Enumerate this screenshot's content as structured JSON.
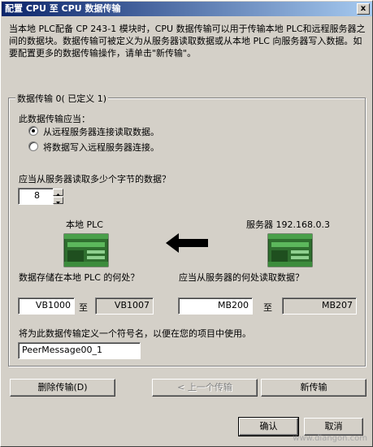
{
  "window": {
    "title": "配置 CPU 至 CPU 数据传输",
    "close_glyph": "x"
  },
  "description": "当本地 PLC配备 CP 243-1 模块时，CPU 数据传输可以用于传输本地 PLC和远程服务器之间的数据块。数据传输可被定义为从服务器读取数据或从本地 PLC 向服务器写入数据。如要配置更多的数据传输操作，请单击\"新传输\"。",
  "group": {
    "legend": "数据传输 0( 已定义 1)",
    "direction_prompt": "此数据传输应当：",
    "options": [
      {
        "label": "从远程服务器连接读取数据。",
        "selected": true
      },
      {
        "label": "将数据写入远程服务器连接。",
        "selected": false
      }
    ],
    "bytes_prompt": "应当从服务器读取多少个字节的数据？",
    "bytes_value": "8",
    "local_label": "本地 PLC",
    "server_label": "服务器 192.168.0.3",
    "local_store_prompt": "数据存储在本地 PLC 的何处？",
    "server_read_prompt": "应当从服务器的何处读取数据？",
    "local_from": "VB1000",
    "local_to_word": "至",
    "local_to": "VB1007",
    "server_from": "MB200",
    "server_to_word": "至",
    "server_to": "MB207",
    "symbol_prompt": "将为此数据传输定义一个符号名，以便在您的项目中使用。",
    "symbol_value": "PeerMessage00_1"
  },
  "buttons": {
    "delete": "删除传输(D)",
    "prev": "< 上一个传输",
    "new": "新传输",
    "ok": "确认",
    "cancel": "取消"
  },
  "watermark": "www.diangon.com",
  "colors": {
    "titlebar_start": "#0a246a",
    "titlebar_end": "#a6caf0",
    "face": "#d4d0c8",
    "plc_green": "#3c8c3c",
    "arrow": "#000000"
  }
}
